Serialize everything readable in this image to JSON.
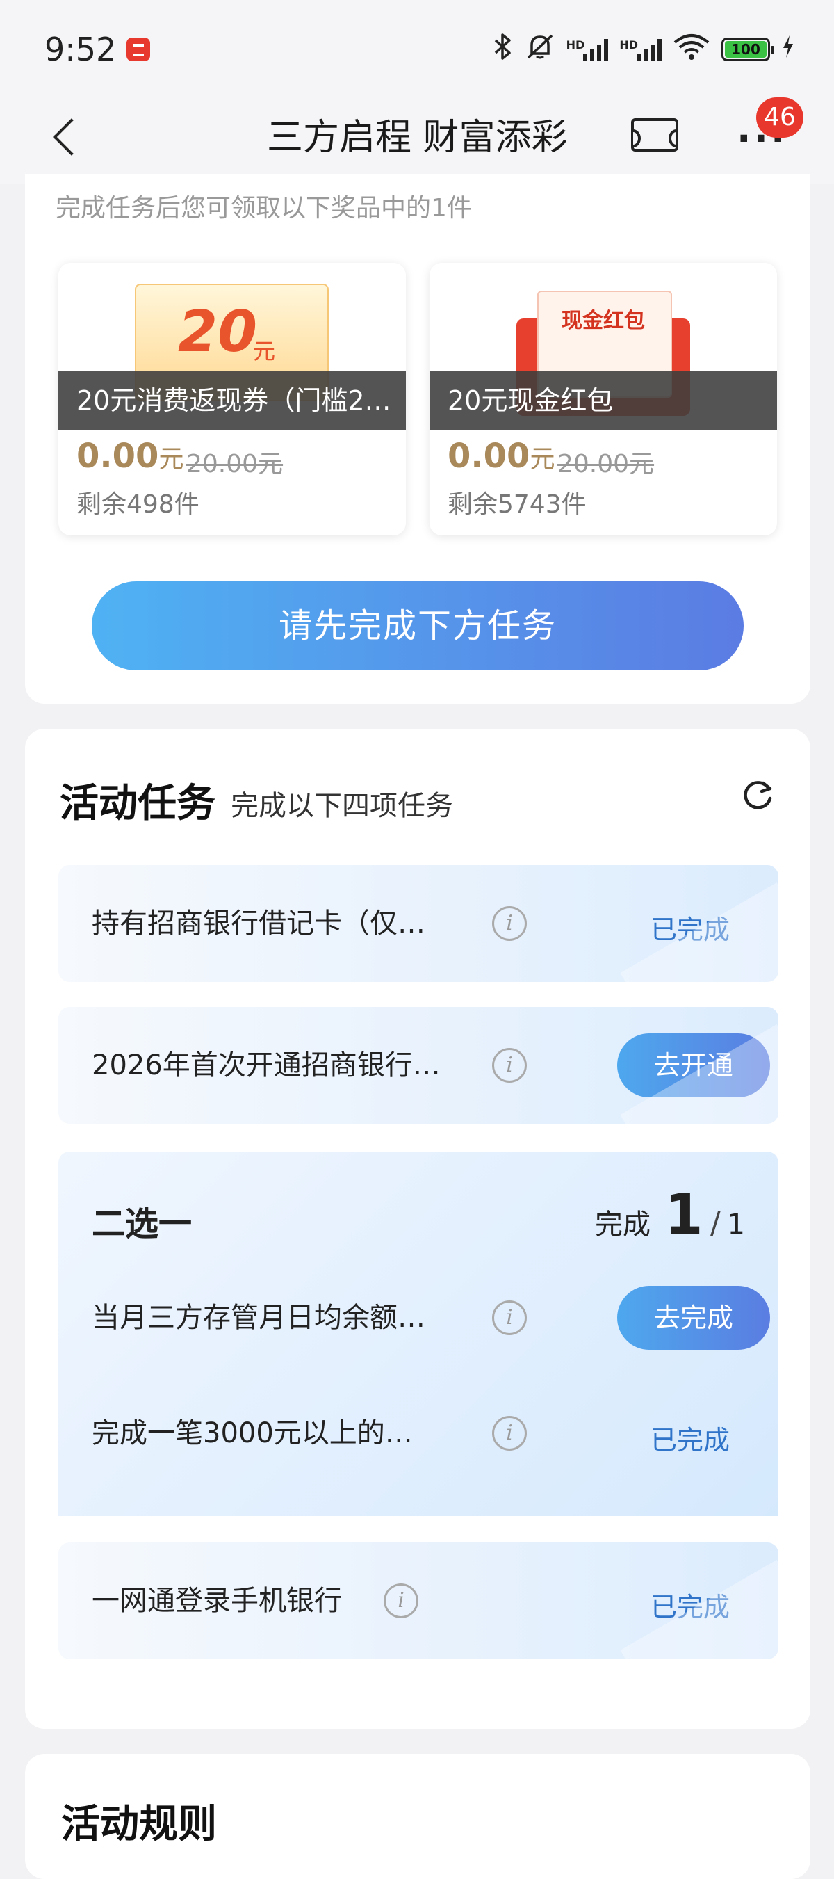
{
  "status_bar": {
    "time": "9:52",
    "battery": "100",
    "icons": [
      "bluetooth-icon",
      "mute-icon",
      "hd-signal-icon",
      "hd-signal-icon",
      "wifi-icon",
      "battery-icon",
      "charging-icon"
    ]
  },
  "nav": {
    "title": "三方启程 财富添彩",
    "more_badge": "46",
    "icons": [
      "back-icon",
      "ticket-icon",
      "more-icon"
    ]
  },
  "rewards": {
    "hint": "完成任务后您可领取以下奖品中的1件",
    "items": [
      {
        "image_text_amount": "20",
        "image_text_unit": "元",
        "label": "20元消费返现券（门槛2…",
        "price": "0.00",
        "price_unit": "元",
        "original_price": "20.00元",
        "stock": "剩余498件"
      },
      {
        "image_text": "现金红包",
        "label": "20元现金红包",
        "price": "0.00",
        "price_unit": "元",
        "original_price": "20.00元",
        "stock": "剩余5743件"
      }
    ],
    "cta": "请先完成下方任务"
  },
  "tasks": {
    "title": "活动任务",
    "subtitle": "完成以下四项任务",
    "items": [
      {
        "text": "持有招商银行借记卡（仅…",
        "status": "已完成"
      },
      {
        "text": "2026年首次开通招商银行…",
        "action": "去开通"
      }
    ],
    "group": {
      "title": "二选一",
      "progress_label": "完成",
      "progress_done": "1",
      "progress_sep": "/",
      "progress_total": "1",
      "items": [
        {
          "text": "当月三方存管月日均余额…",
          "action": "去完成"
        },
        {
          "text": "完成一笔3000元以上的…",
          "status": "已完成"
        }
      ]
    },
    "last": {
      "text": "一网通登录手机银行",
      "status": "已完成"
    },
    "info_glyph": "i"
  },
  "rules": {
    "title": "活动规则"
  },
  "colors": {
    "accent_blue": "#2f74c9",
    "button_gradient_start": "#4fb2f3",
    "button_gradient_end": "#5b7ce3",
    "badge_red": "#e8382d",
    "price_gold": "#a9895a"
  }
}
